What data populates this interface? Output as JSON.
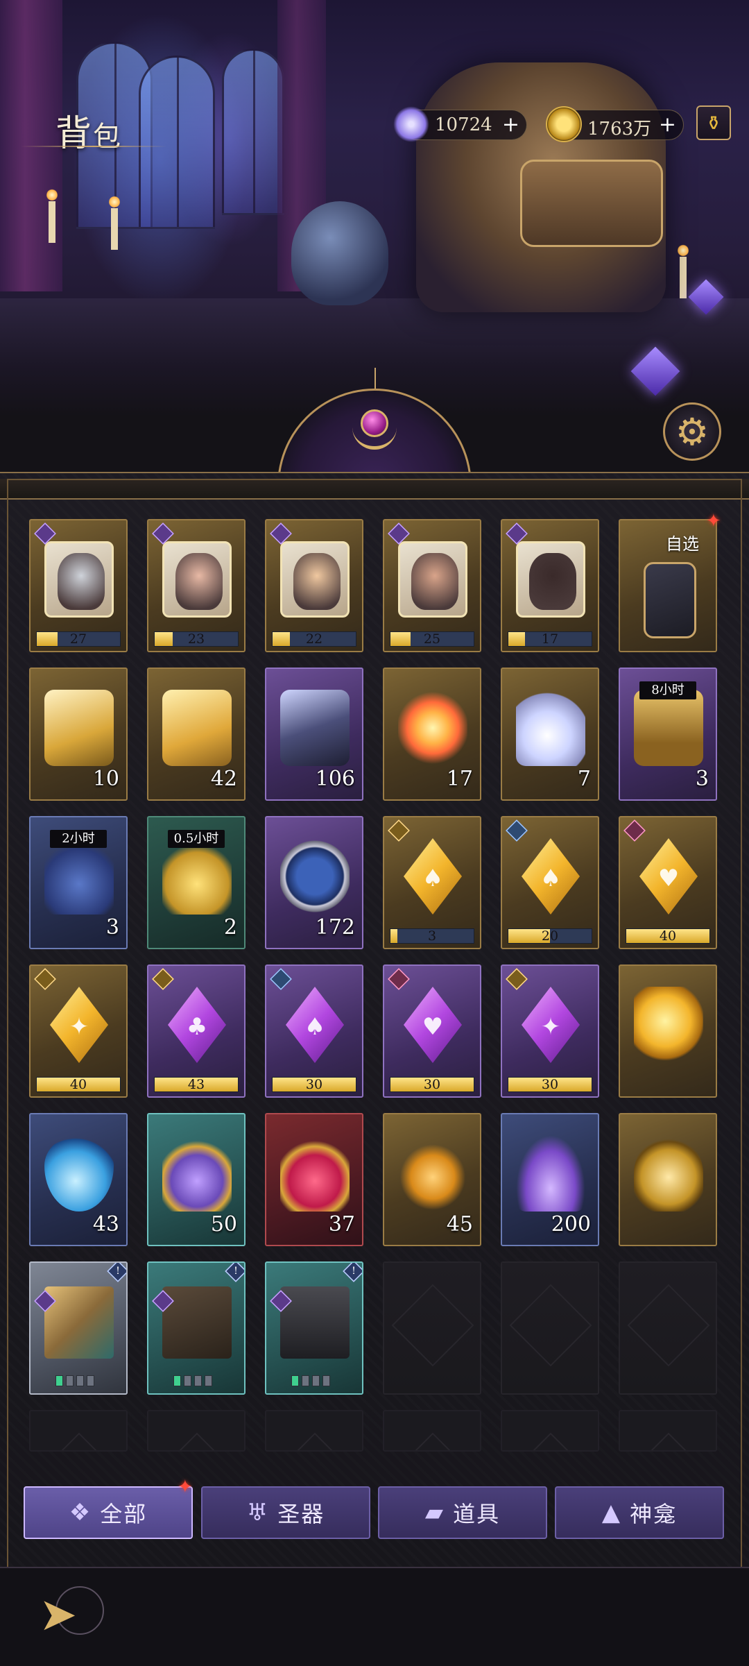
{
  "header": {
    "title_big": "背",
    "title_small": "包",
    "currencies": [
      {
        "icon": "star-crystal-icon",
        "value": "10724",
        "plus": "+"
      },
      {
        "icon": "gold-coin-icon",
        "value": "1763万",
        "plus": "+"
      }
    ],
    "shop_icon": "potion-bag-icon",
    "settings_icon": "gear-icon"
  },
  "items": [
    {
      "type": "puzzle",
      "frame": "gold",
      "rank": "purple",
      "count": "27",
      "progress": 0.25
    },
    {
      "type": "puzzle",
      "frame": "gold",
      "rank": "purple",
      "count": "23",
      "progress": 0.22
    },
    {
      "type": "puzzle",
      "frame": "gold",
      "rank": "purple",
      "count": "22",
      "progress": 0.21
    },
    {
      "type": "puzzle",
      "frame": "gold",
      "rank": "purple",
      "count": "25",
      "progress": 0.24
    },
    {
      "type": "puzzle",
      "frame": "gold",
      "rank": "purple",
      "count": "17",
      "progress": 0.2
    },
    {
      "type": "card-select",
      "frame": "gold",
      "label": "自选"
    },
    {
      "type": "feather-spade",
      "frame": "gold",
      "count": "10"
    },
    {
      "type": "feather-gold",
      "frame": "gold",
      "count": "42"
    },
    {
      "type": "feather-dark",
      "frame": "purple",
      "count": "106"
    },
    {
      "type": "fireworks",
      "frame": "gold",
      "count": "17"
    },
    {
      "type": "bottle",
      "frame": "gold",
      "count": "7"
    },
    {
      "type": "chest",
      "frame": "purple",
      "timer": "8小时",
      "count": "3"
    },
    {
      "type": "coin-bag",
      "frame": "blue",
      "timer": "2小时",
      "count": "3"
    },
    {
      "type": "coin-stack",
      "frame": "green",
      "timer": "0.5小时",
      "count": "2"
    },
    {
      "type": "exchange-token",
      "frame": "purple",
      "count": "172"
    },
    {
      "type": "gem-yellow",
      "frame": "gold",
      "rank": "gold",
      "symbol": "♠",
      "count": "3",
      "progress": 0.08
    },
    {
      "type": "gem-yellow",
      "frame": "gold",
      "rank": "blue",
      "symbol": "♠",
      "count": "20",
      "progress": 0.5
    },
    {
      "type": "gem-yellow",
      "frame": "gold",
      "rank": "pink",
      "symbol": "♥",
      "count": "40",
      "progress": 1.0
    },
    {
      "type": "gem-yellow",
      "frame": "gold",
      "rank": "gold",
      "symbol": "✦",
      "count": "40",
      "progress": 1.0
    },
    {
      "type": "gem-violet",
      "frame": "purple",
      "rank": "gold",
      "symbol": "♣",
      "count": "43",
      "progress": 1.0
    },
    {
      "type": "gem-violet",
      "frame": "purple",
      "rank": "blue",
      "symbol": "♠",
      "count": "30",
      "progress": 1.0
    },
    {
      "type": "gem-violet",
      "frame": "purple",
      "rank": "pink",
      "symbol": "♥",
      "count": "30",
      "progress": 1.0
    },
    {
      "type": "gem-violet",
      "frame": "purple",
      "rank": "gold",
      "symbol": "✦",
      "count": "30",
      "progress": 1.0
    },
    {
      "type": "gem-refresh",
      "frame": "gold"
    },
    {
      "type": "water-drop",
      "frame": "blue",
      "count": "43"
    },
    {
      "type": "heart-bottle-blue",
      "frame": "teal",
      "count": "50"
    },
    {
      "type": "heart-bottle-red",
      "frame": "red",
      "count": "37"
    },
    {
      "type": "orb-staff",
      "frame": "gold",
      "count": "45"
    },
    {
      "type": "crystal-pile",
      "frame": "blue",
      "count": "200"
    },
    {
      "type": "bell",
      "frame": "gold"
    },
    {
      "type": "telescope",
      "frame": "silver",
      "badge": "!",
      "slots_on": 1
    },
    {
      "type": "book",
      "frame": "teal",
      "badge": "!",
      "slots_on": 1
    },
    {
      "type": "door",
      "frame": "teal",
      "badge": "!",
      "slots_on": 1
    }
  ],
  "tabs": [
    {
      "label": "全部",
      "icon": "grid-icon",
      "active": true
    },
    {
      "label": "圣器",
      "icon": "chalice-icon",
      "active": false
    },
    {
      "label": "道具",
      "icon": "gold-bars-icon",
      "active": false
    },
    {
      "label": "神龛",
      "icon": "shrine-icon",
      "active": false
    }
  ],
  "footer": {
    "back_icon": "back-arrow-icon"
  }
}
